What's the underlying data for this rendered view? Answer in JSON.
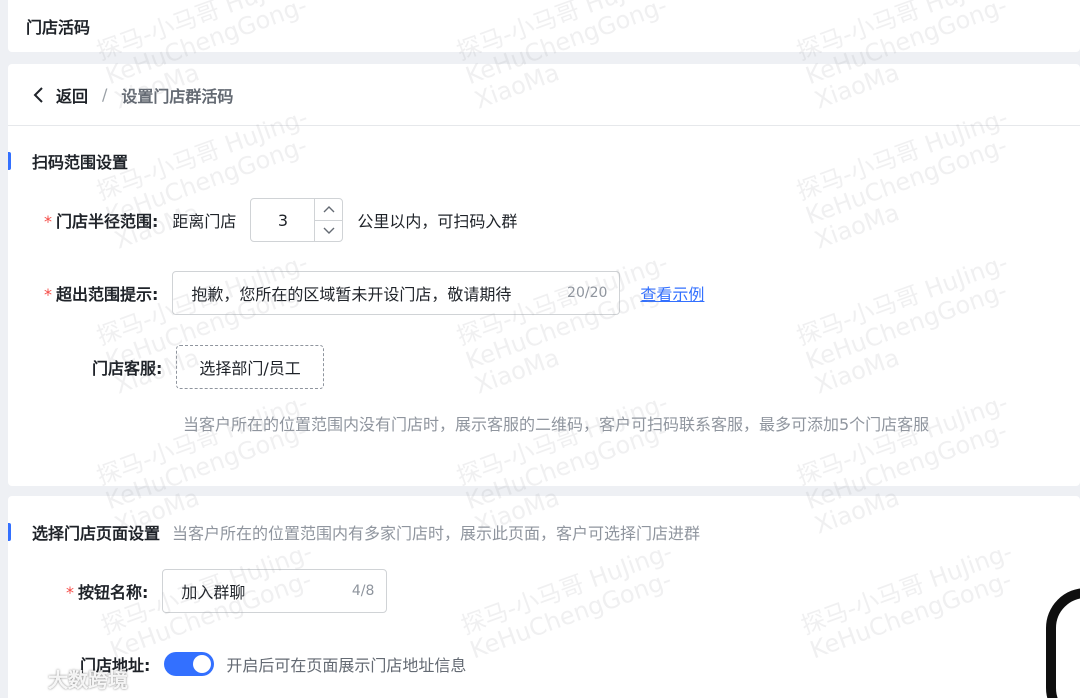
{
  "header": {
    "title": "门店活码"
  },
  "breadcrumb": {
    "back_label": "返回",
    "separator": "/",
    "current": "设置门店群活码"
  },
  "scan_range": {
    "title": "扫码范围设置",
    "radius": {
      "required_mark": "*",
      "label": "门店半径范围:",
      "prefix": "距离门店",
      "value": "3",
      "suffix": "公里以内，可扫码入群"
    },
    "out_of_range": {
      "required_mark": "*",
      "label": "超出范围提示:",
      "value": "抱歉，您所在的区域暂未开设门店，敬请期待",
      "counter": "20/20",
      "example_link": "查看示例"
    },
    "service": {
      "label": "门店客服:",
      "button": "选择部门/员工",
      "hint": "当客户所在的位置范围内没有门店时，展示客服的二维码，客户可扫码联系客服，最多可添加5个门店客服"
    }
  },
  "store_page": {
    "title": "选择门店页面设置",
    "desc": "当客户所在的位置范围内有多家门店时，展示此页面，客户可选择门店进群",
    "button_name": {
      "required_mark": "*",
      "label": "按钮名称:",
      "value": "加入群聊",
      "counter": "4/8"
    },
    "address": {
      "label": "门店地址:",
      "enabled": true,
      "text": "开启后可在页面展示门店地址信息"
    }
  },
  "watermark": {
    "line1": "探马-小马哥 HuJing-",
    "line2": "KeHuChengGong-",
    "line3": "XiaoMa"
  },
  "brand": {
    "text": "大数跨境"
  },
  "colors": {
    "accent": "#3370ff",
    "required": "#f54a45",
    "muted": "#8f959e"
  }
}
